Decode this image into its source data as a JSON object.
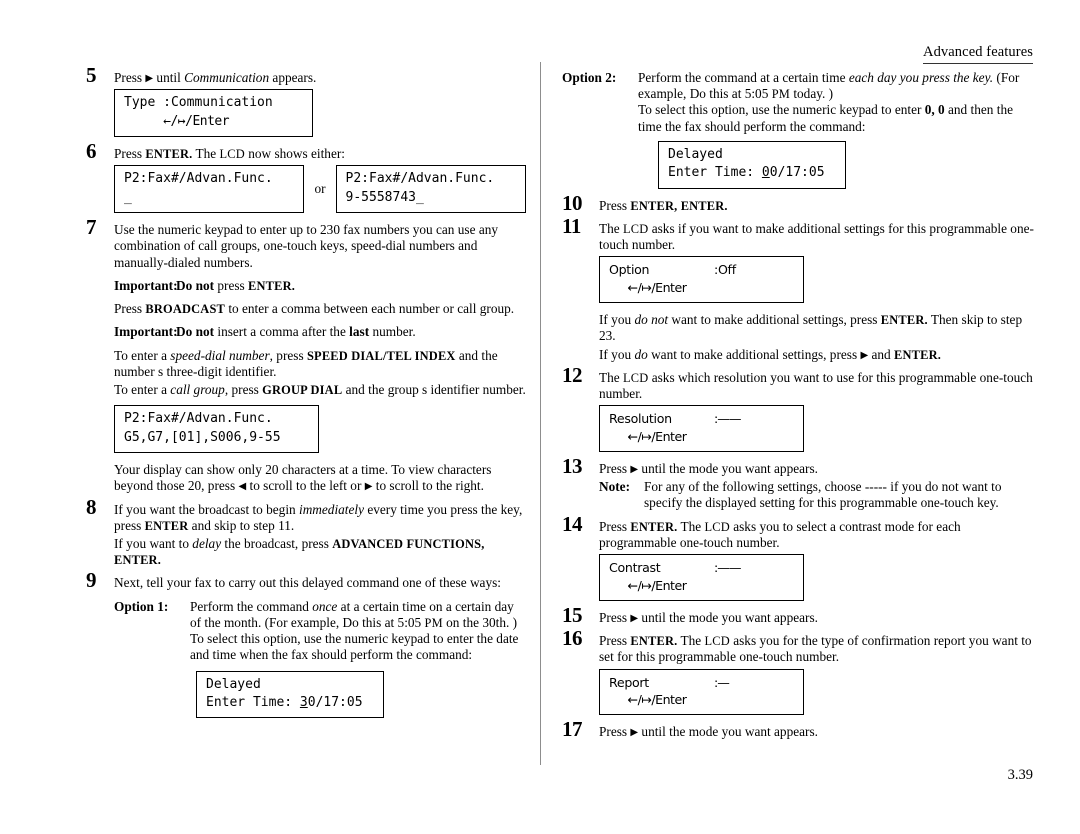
{
  "header": {
    "running_head": "Advanced features"
  },
  "footer": {
    "page_number": "3.39"
  },
  "left_column": {
    "step5": {
      "num": "5",
      "text_before": "Press ",
      "arrow": "▶",
      "text_mid": " until ",
      "italic": "Communication",
      "text_after": " appears.",
      "lcd": {
        "line1": "Type :Communication",
        "line2": "←/↦/Enter"
      }
    },
    "step6": {
      "num": "6",
      "text_before": "Press ",
      "key": "ENTER.",
      "text_mid": " The ",
      "lcd_word": "LCD",
      "text_after": " now shows either:",
      "lcd_a": {
        "line1": "P2:Fax#/Advan.Func.",
        "line2": "_"
      },
      "or_label": "or",
      "lcd_b": {
        "line1": "P2:Fax#/Advan.Func.",
        "line2": "9-5558743_"
      }
    },
    "step7": {
      "num": "7",
      "intro": "Use the numeric keypad to enter up to 230 fax numbers  you can use any combination of call groups, one-touch keys, speed-dial numbers and manually-dialed numbers.",
      "important1_label": "Important:",
      "important1_bold": "Do not",
      "important1_rest": " press ",
      "important1_key": "ENTER.",
      "broadcast_before": "Press ",
      "broadcast_key": "BROADCAST",
      "broadcast_after": " to enter a comma between each number or call group.",
      "important2_label": "Important:",
      "important2_bold": "Do not",
      "important2_rest_a": " insert a comma after the ",
      "important2_bold2": "last",
      "important2_rest_b": " number.",
      "speed_a": "To enter a ",
      "speed_italic": "speed-dial number",
      "speed_b": ", press ",
      "speed_key": "SPEED DIAL/TEL INDEX",
      "speed_c": " and the number s three-digit identifier.",
      "group_a": "To enter a ",
      "group_italic": "call group",
      "group_b": ", press ",
      "group_key": "GROUP DIAL",
      "group_c": " and the group s identifier number.",
      "lcd": {
        "line1": "P2:Fax#/Advan.Func.",
        "line2": "G5,G7,[01],S006,9-55"
      },
      "display_note_a": "Your display can show only 20 characters at a time. To view characters beyond those 20, press ",
      "display_note_arrow_left": "◀",
      "display_note_b": " to scroll to the left or ",
      "display_note_arrow_right": "▶",
      "display_note_c": " to scroll to the right."
    },
    "step8": {
      "num": "8",
      "a": "If you want the broadcast to begin ",
      "italic": "immediately",
      "b": " every time you press the key, press ",
      "key1": "ENTER",
      "c": " and skip to step 11.",
      "d": "If you want to ",
      "italic2": "delay",
      "e": " the broadcast, press ",
      "key2": "ADVANCED FUNCTIONS, ENTER."
    },
    "step9": {
      "num": "9",
      "text": "Next, tell your fax to carry out this delayed command one of these ways:",
      "option1_label": "Option 1:",
      "option1_a": "Perform the command ",
      "option1_italic": "once",
      "option1_b": " at a certain time on a certain day of the month. (For example,  Do this at 5:05 ",
      "option1_pm": "PM",
      "option1_c": " on the 30th. )",
      "option1_d": "To select this option, use the numeric keypad to enter the date and time when the fax should perform the command:",
      "lcd": {
        "line1": "Delayed",
        "line2_pre": "Enter Time: ",
        "line2_cursor": "3",
        "line2_post": "0/17:05"
      }
    }
  },
  "right_column": {
    "option2": {
      "label": "Option 2:",
      "a": "Perform the command at a certain time ",
      "italic": "each day you press the key.",
      "b": " (For example,  Do this at 5:05 ",
      "pm": "PM",
      "c": " today. )",
      "d_a": "To select this option, use the numeric keypad to enter ",
      "d_bold": "0, 0",
      "d_b": " and then the time the fax should perform the command:",
      "lcd": {
        "line1": "Delayed",
        "line2_pre": "Enter Time: ",
        "line2_cursor": "0",
        "line2_post": "0/17:05"
      }
    },
    "step10": {
      "num": "10",
      "a": "Press ",
      "key": "ENTER, ENTER."
    },
    "step11": {
      "num": "11",
      "a": "The ",
      "lcd_word": "LCD",
      "b": " asks if you want to make additional settings for this programmable one-touch number.",
      "lcd": {
        "label": "Option",
        "value": ":Off",
        "line2": "←/↦/Enter"
      },
      "note_a": "If you ",
      "note_italic": "do not",
      "note_b": " want to make additional settings, press ",
      "note_key": "ENTER.",
      "note_c": " Then skip to step 23.",
      "note2_a": "If you ",
      "note2_italic": "do",
      "note2_b": " want to make additional settings, press ",
      "note2_arrow": "▶",
      "note2_c": " and ",
      "note2_key": "ENTER."
    },
    "step12": {
      "num": "12",
      "a": "The ",
      "lcd_word": "LCD",
      "b": " asks which resolution you want to use for this programmable one-touch number.",
      "lcd": {
        "label": "Resolution",
        "value": ":——",
        "line2": "←/↦/Enter"
      }
    },
    "step13": {
      "num": "13",
      "a": "Press ",
      "arrow": "▶",
      "b": " until the mode you want appears.",
      "note_label": "Note:",
      "note_text": "For any of the following settings, choose  -----  if you do not want to specify the displayed setting for this programmable one-touch key."
    },
    "step14": {
      "num": "14",
      "a": "Press ",
      "key": "ENTER.",
      "b": " The ",
      "lcd_word": "LCD",
      "c": " asks you to select a contrast mode for each programmable one-touch number.",
      "lcd": {
        "label": "Contrast",
        "value": ":——",
        "line2": "←/↦/Enter"
      }
    },
    "step15": {
      "num": "15",
      "a": "Press ",
      "arrow": "▶",
      "b": " until the mode you want appears."
    },
    "step16": {
      "num": "16",
      "a": "Press ",
      "key": "ENTER.",
      "b": " The ",
      "lcd_word": "LCD",
      "c": " asks you for the type of confirmation report you want to set for this programmable one-touch number.",
      "lcd": {
        "label": "Report",
        "value": ":—",
        "line2": "←/↦/Enter"
      }
    },
    "step17": {
      "num": "17",
      "a": "Press ",
      "arrow": "▶",
      "b": " until the mode you want appears."
    }
  }
}
